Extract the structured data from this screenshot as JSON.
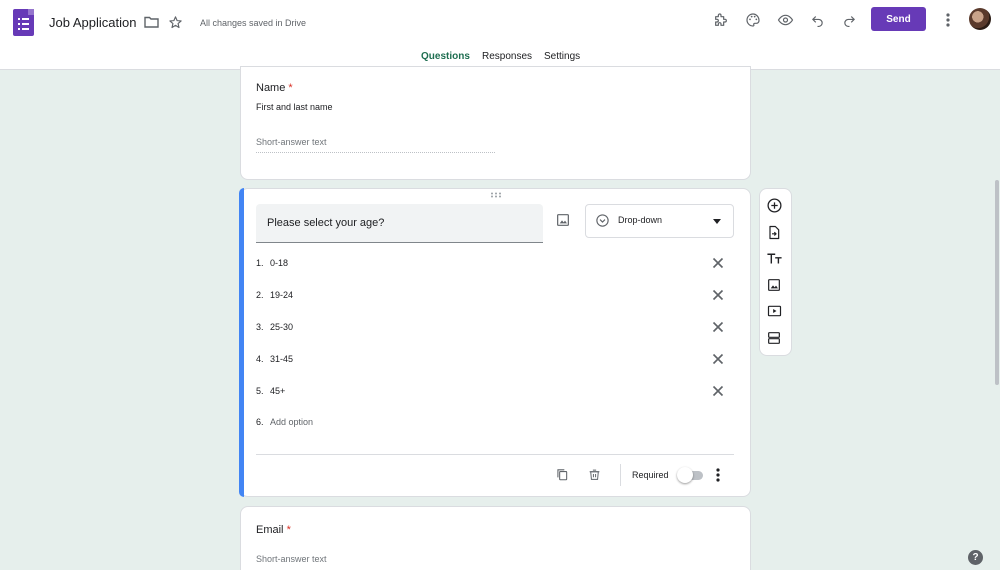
{
  "header": {
    "title": "Job Application",
    "save_status": "All changes saved in Drive",
    "send_label": "Send"
  },
  "tabs": [
    {
      "label": "Questions",
      "active": true
    },
    {
      "label": "Responses",
      "active": false
    },
    {
      "label": "Settings",
      "active": false
    }
  ],
  "questions": [
    {
      "title": "Name",
      "required_mark": "*",
      "description": "First and last name",
      "answer_placeholder": "Short-answer text"
    },
    {
      "title": "Please select your age?",
      "type": "Drop-down",
      "options": [
        {
          "num": "1.",
          "label": "0-18"
        },
        {
          "num": "2.",
          "label": "19-24"
        },
        {
          "num": "3.",
          "label": "25-30"
        },
        {
          "num": "4.",
          "label": "31-45"
        },
        {
          "num": "5.",
          "label": "45+"
        }
      ],
      "add_option": {
        "num": "6.",
        "label": "Add option"
      },
      "required_label": "Required",
      "required": false
    },
    {
      "title": "Email",
      "required_mark": "*",
      "answer_placeholder": "Short-answer text"
    }
  ],
  "help": "?",
  "colors": {
    "brand": "#673ab7",
    "active_tab": "#1e6e50",
    "focus_bar": "#4285f4",
    "background": "#e6efec"
  }
}
